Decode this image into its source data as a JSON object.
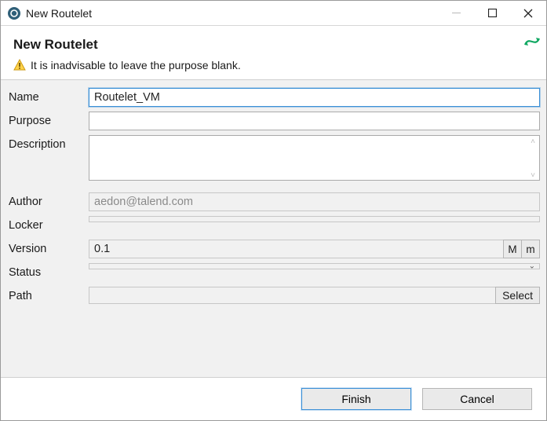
{
  "window": {
    "title": "New Routelet"
  },
  "header": {
    "heading": "New Routelet",
    "warning": "It is inadvisable to leave the purpose blank."
  },
  "labels": {
    "name": "Name",
    "purpose": "Purpose",
    "description": "Description",
    "author": "Author",
    "locker": "Locker",
    "version": "Version",
    "status": "Status",
    "path": "Path"
  },
  "fields": {
    "name": "Routelet_VM",
    "purpose": "",
    "description": "",
    "author": "aedon@talend.com",
    "locker": "",
    "version": "0.1",
    "status": "",
    "path": ""
  },
  "buttons": {
    "majorVersion": "M",
    "minorVersion": "m",
    "selectPath": "Select",
    "finish": "Finish",
    "cancel": "Cancel"
  },
  "icons": {
    "app": "app-icon",
    "warning": "warning-icon",
    "route": "route-icon"
  }
}
